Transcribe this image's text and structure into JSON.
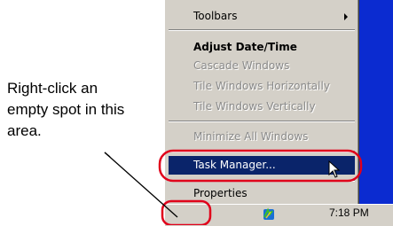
{
  "menu": {
    "toolbars": "Toolbars",
    "adjust": "Adjust Date/Time",
    "cascade": "Cascade Windows",
    "tile_h": "Tile Windows Horizontally",
    "tile_v": "Tile Windows Vertically",
    "minimize": "Minimize All Windows",
    "task_manager": "Task Manager...",
    "properties": "Properties"
  },
  "taskbar": {
    "clock": "7:18 PM"
  },
  "annotation": {
    "text": "Right-click an empty spot in this area."
  },
  "colors": {
    "desktop": "#0b2bd0",
    "selection": "#0a246a",
    "highlight_ring": "#e0001b"
  }
}
